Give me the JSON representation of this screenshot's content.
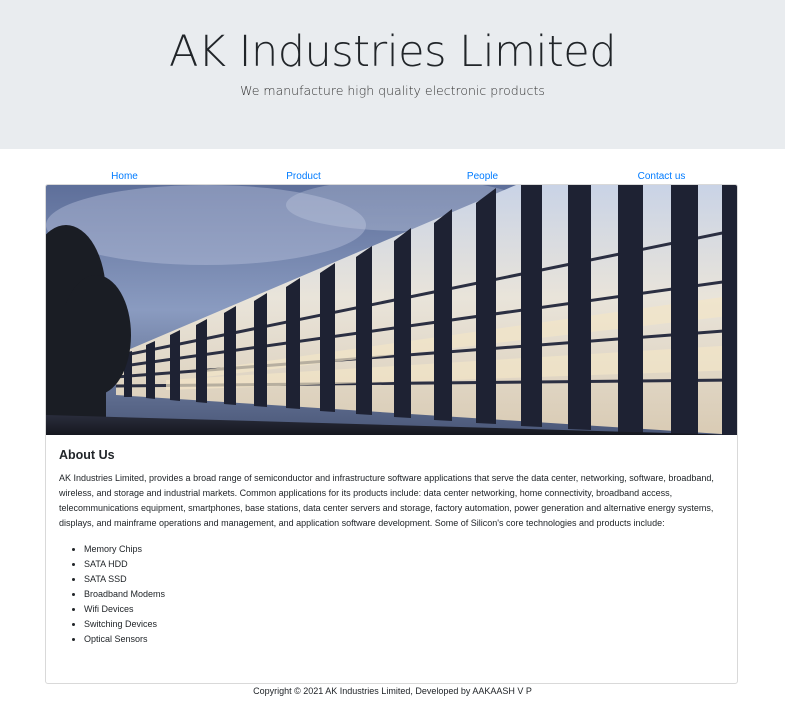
{
  "header": {
    "title": "AK Industries Limited",
    "subtitle": "We manufacture high quality electronic products"
  },
  "nav": {
    "items": [
      {
        "label": "Home"
      },
      {
        "label": "Product"
      },
      {
        "label": "People"
      },
      {
        "label": "Contact us"
      }
    ]
  },
  "about": {
    "heading": "About Us",
    "text": "AK Industries Limited, provides a broad range of semiconductor and infrastructure software applications that serve the data center, networking, software, broadband, wireless, and storage and industrial markets. Common applications for its products include: data center networking, home connectivity, broadband access, telecommunications equipment, smartphones, base stations, data center servers and storage, factory automation, power generation and alternative energy systems, displays, and mainframe operations and management, and application software development. Some of Silicon's core technologies and products include:",
    "items": [
      "Memory Chips",
      "SATA HDD",
      "SATA SSD",
      "Broadband Modems",
      "Wifi Devices",
      "Switching Devices",
      "Optical Sensors"
    ]
  },
  "footer": {
    "text": "Copyright © 2021 AK Industries Limited, Developed by AAKAASH V P"
  }
}
